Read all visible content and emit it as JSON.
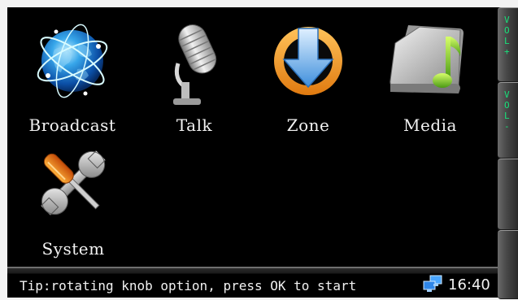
{
  "apps": {
    "broadcast": "Broadcast",
    "talk": "Talk",
    "zone": "Zone",
    "media": "Media",
    "system": "System"
  },
  "status": {
    "tip": "Tip:rotating knob option, press OK to start",
    "time": "16:40",
    "network_icon": "network-computers-icon"
  },
  "side_buttons": {
    "vol_up": "V\nO\nL\n+",
    "vol_down": "V\nO\nL\n-"
  },
  "colors": {
    "screen_bg": "#000000",
    "label_text": "#f2f2f2",
    "side_text": "#19e07a",
    "zone_orange": "#f29a1e",
    "zone_arrow": "#6fb4ee"
  }
}
